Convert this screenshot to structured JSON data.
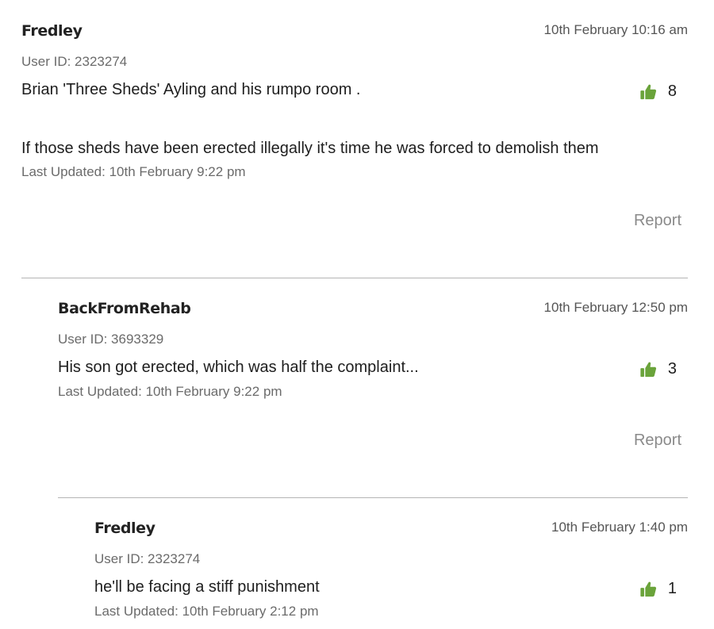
{
  "comments": [
    {
      "author": "Fredley",
      "timestamp": "10th February 10:16 am",
      "user_id": "User ID: 2323274",
      "body": [
        "Brian 'Three Sheds' Ayling and his rumpo room .",
        "If those sheds have been erected illegally it's time he was forced to demolish them"
      ],
      "last_updated": "Last Updated: 10th February 9:22 pm",
      "likes": "8",
      "report_label": "Report"
    },
    {
      "author": "BackFromRehab",
      "timestamp": "10th February 12:50 pm",
      "user_id": "User ID: 3693329",
      "body": [
        "His son got erected, which was half the complaint..."
      ],
      "last_updated": "Last Updated: 10th February 9:22 pm",
      "likes": "3",
      "report_label": "Report"
    },
    {
      "author": "Fredley",
      "timestamp": "10th February 1:40 pm",
      "user_id": "User ID: 2323274",
      "body": [
        "he'll be facing a stiff punishment"
      ],
      "last_updated": "Last Updated: 10th February 2:12 pm",
      "likes": "1"
    }
  ],
  "icons": {
    "like": "thumbs-up-icon"
  },
  "colors": {
    "like_icon": "#6aa33a",
    "report_text": "#8a8a8a",
    "meta_text": "#6b6b6b",
    "divider": "#b5b5b5"
  }
}
